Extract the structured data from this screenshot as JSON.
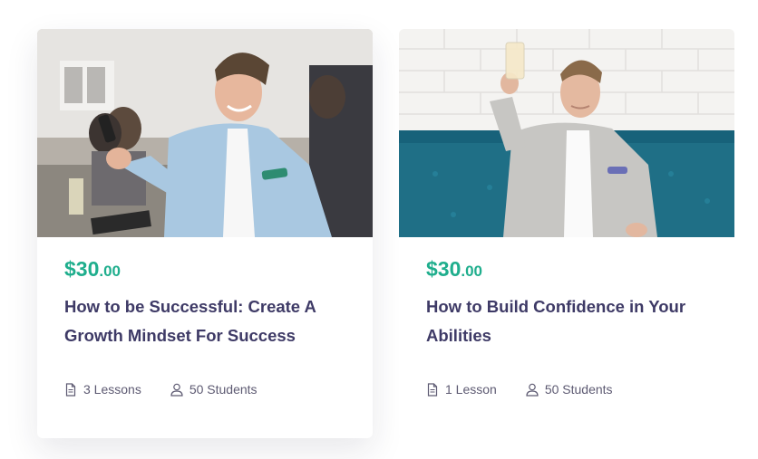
{
  "courses": [
    {
      "price_main": "$30",
      "price_cents": ".00",
      "title": "How to be Successful: Create A Growth Mindset For Success",
      "lessons": "3 Lessons",
      "students": "50 Students",
      "image": "photo-man-smiling-at-phone"
    },
    {
      "price_main": "$30",
      "price_cents": ".00",
      "title": "How to Build Confidence in Your Abilities",
      "lessons": "1 Lesson",
      "students": "50 Students",
      "image": "photo-man-raising-glass"
    }
  ],
  "icons": {
    "lessons": "document-icon",
    "students": "user-icon"
  },
  "colors": {
    "price": "#1fae8d",
    "title": "#3e3a66",
    "meta": "#5d5a72"
  }
}
